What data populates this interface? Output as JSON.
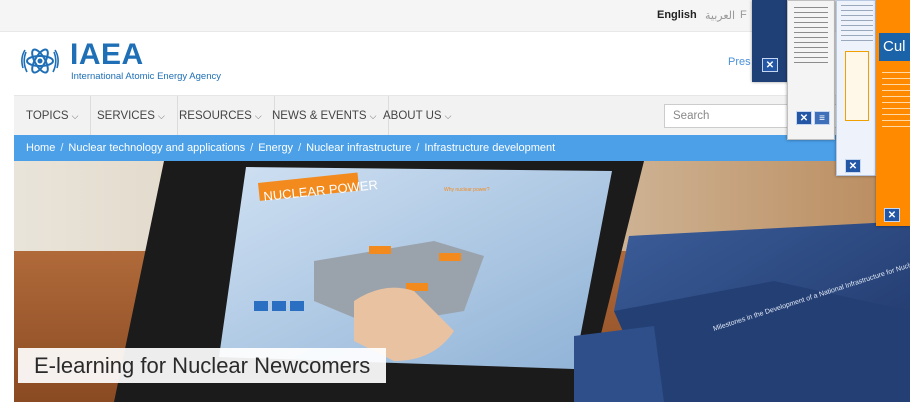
{
  "languages": {
    "english": "English",
    "arabic": "العربية",
    "third": "F"
  },
  "header": {
    "logo_title": "IAEA",
    "logo_subtitle": "International Atomic Energy Agency",
    "press_link": "Pres"
  },
  "nav": {
    "items": [
      {
        "label": "TOPICS"
      },
      {
        "label": "SERVICES"
      },
      {
        "label": "RESOURCES"
      },
      {
        "label": "NEWS & EVENTS"
      },
      {
        "label": "ABOUT US"
      }
    ],
    "chevron": "⌵",
    "search_placeholder": "Search"
  },
  "breadcrumb": {
    "items": [
      "Home",
      "Nuclear technology and applications",
      "Energy",
      "Nuclear infrastructure",
      "Infrastructure development"
    ],
    "separator": "/"
  },
  "hero": {
    "caption": "E-learning for Nuclear Newcomers",
    "laptop_heading": "NUCLEAR POWER",
    "laptop_subheading": "Why nuclear power?",
    "book_title": "Milestones in the Development of a National Infrastructure for Nuclear Power"
  },
  "overlay_popups": {
    "popup_d_title": "Cul",
    "close_glyph": "✕"
  },
  "colors": {
    "brand_blue": "#1e6fb6",
    "breadcrumb_bg": "#4ba0e8",
    "nav_bg": "#f2f2f2",
    "popup_orange": "#ff8a00"
  }
}
